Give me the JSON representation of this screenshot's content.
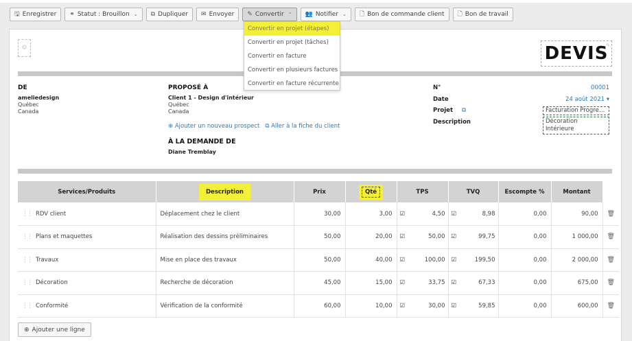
{
  "toolbar": {
    "save": "Enregistrer",
    "status": "Statut : Brouillon",
    "duplicate": "Dupliquer",
    "send": "Envoyer",
    "convert": "Convertir",
    "notify": "Notifier",
    "client_order": "Bon de commande client",
    "work_order": "Bon de travail"
  },
  "convert_menu": [
    "Convertir en projet (étapes)",
    "Convertir en projet (tâches)",
    "Convertir en facture",
    "Convertir en plusieurs factures",
    "Convertir en facture récurrente"
  ],
  "document": {
    "title": "DEVIS",
    "from": {
      "heading": "DE",
      "name": "ameliedesign",
      "region": "Québec",
      "country": "Canada"
    },
    "to": {
      "heading": "PROPOSÉ À",
      "name": "Client 1 - Design d'intérieur",
      "region": "Québec",
      "country": "Canada"
    },
    "links": {
      "add_prospect": "Ajouter un nouveau prospect",
      "client_sheet": "Aller à la fiche du client"
    },
    "requested_by": {
      "heading": "À LA DEMANDE DE",
      "name": "Diane Tremblay"
    },
    "meta": {
      "number_label": "N°",
      "number": "00001",
      "date_label": "Date",
      "date": "24 août 2021",
      "project_label": "Projet",
      "project": "Facturation Progre…",
      "description_label": "Description",
      "description_line1": "Décoration",
      "description_line2": "Intérieure"
    }
  },
  "table": {
    "headers": [
      "Services/Produits",
      "Description",
      "Prix",
      "Qté",
      "TPS",
      "TVQ",
      "Escompte %",
      "Montant"
    ],
    "rows": [
      {
        "service": "RDV client",
        "description": "Déplacement chez le client",
        "price": "30,00",
        "qty": "3,00",
        "tps": "4,50",
        "tvq": "8,98",
        "discount": "0,00",
        "amount": "90,00"
      },
      {
        "service": "Plans et maquettes",
        "description": "Réalisation des dessins préliminaires",
        "price": "50,00",
        "qty": "20,00",
        "tps": "50,00",
        "tvq": "99,75",
        "discount": "0,00",
        "amount": "1 000,00"
      },
      {
        "service": "Travaux",
        "description": "Mise en place des travaux",
        "price": "50,00",
        "qty": "40,00",
        "tps": "100,00",
        "tvq": "199,50",
        "discount": "0,00",
        "amount": "2 000,00"
      },
      {
        "service": "Décoration",
        "description": "Recherche de décoration",
        "price": "45,00",
        "qty": "15,00",
        "tps": "33,75",
        "tvq": "67,33",
        "discount": "0,00",
        "amount": "675,00"
      },
      {
        "service": "Conformité",
        "description": "Vérification de la conformité",
        "price": "60,00",
        "qty": "10,00",
        "tps": "30,00",
        "tvq": "59,85",
        "discount": "0,00",
        "amount": "600,00"
      }
    ]
  },
  "add_line": "Ajouter une ligne",
  "colors": {
    "link": "#2b7ab5",
    "highlight": "#f4f03a",
    "header_bg": "#d3d3d3"
  }
}
